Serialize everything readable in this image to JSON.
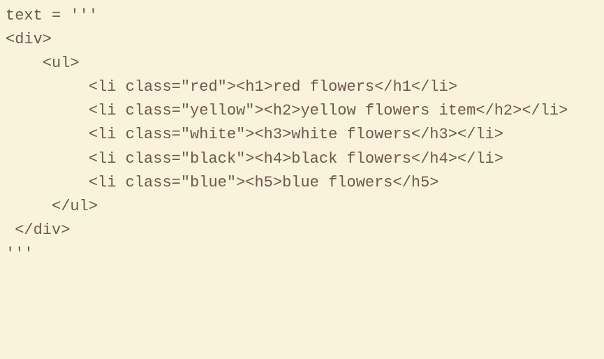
{
  "lines": [
    "text = '''",
    "<div>",
    "    <ul>",
    "         <li class=\"red\"><h1>red flowers</h1</li>",
    "         <li class=\"yellow\"><h2>yellow flowers item</h2></li>",
    "         <li class=\"white\"><h3>white flowers</h3></li>",
    "         <li class=\"black\"><h4>black flowers</h4></li>",
    "         <li class=\"blue\"><h5>blue flowers</h5>",
    "     </ul>",
    " </div>",
    "'''"
  ]
}
